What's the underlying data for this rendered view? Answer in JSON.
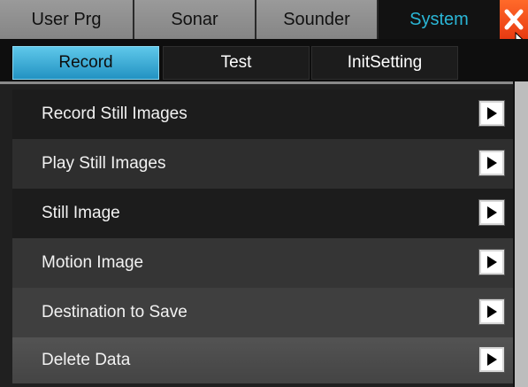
{
  "top_tabs": [
    {
      "label": "User Prg",
      "active": false
    },
    {
      "label": "Sonar",
      "active": false
    },
    {
      "label": "Sounder",
      "active": false
    },
    {
      "label": "System",
      "active": true
    }
  ],
  "sub_tabs": [
    {
      "label": "Record",
      "active": true
    },
    {
      "label": "Test",
      "active": false
    },
    {
      "label": "InitSetting",
      "active": false
    }
  ],
  "menu_items": [
    {
      "label": "Record Still Images",
      "icon": "play-arrow-icon"
    },
    {
      "label": "Play Still Images",
      "icon": "play-arrow-icon"
    },
    {
      "label": "Still Image",
      "icon": "play-arrow-icon"
    },
    {
      "label": "Motion Image",
      "icon": "play-arrow-icon"
    },
    {
      "label": "Destination to Save",
      "icon": "play-arrow-icon"
    },
    {
      "label": "Delete Data",
      "icon": "play-arrow-icon"
    }
  ],
  "colors": {
    "active_tab_text": "#2ab6d6",
    "active_subtab_bg": "#3aaad6",
    "close_button": "#f0501c"
  }
}
